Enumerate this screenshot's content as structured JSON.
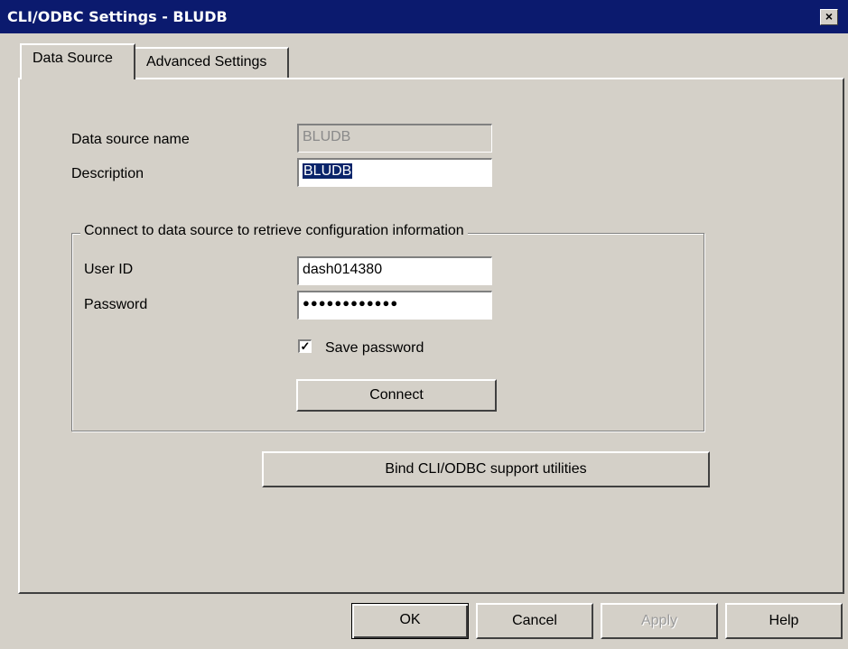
{
  "window": {
    "title": "CLI/ODBC Settings - BLUDB",
    "close_glyph": "×"
  },
  "tabs": [
    {
      "label": "Data Source",
      "active": true
    },
    {
      "label": "Advanced Settings",
      "active": false
    }
  ],
  "form": {
    "data_source_name_label": "Data source name",
    "data_source_name_value": "BLUDB",
    "description_label": "Description",
    "description_value": "BLUDB"
  },
  "connect_group": {
    "legend": "Connect to data source to retrieve configuration information",
    "user_id_label": "User ID",
    "user_id_value": "dash014380",
    "password_label": "Password",
    "password_mask": "●●●●●●●●●●●●",
    "save_password_label": "Save password",
    "save_password_checked": true,
    "checkmark": "✓",
    "connect_button": "Connect"
  },
  "bind_button": "Bind CLI/ODBC support utilities",
  "footer": {
    "ok": "OK",
    "cancel": "Cancel",
    "apply": "Apply",
    "help": "Help"
  },
  "colors": {
    "titlebar": "#0b1a6e",
    "dialog_bg": "#d4d0c8",
    "selection": "#0a246a"
  }
}
